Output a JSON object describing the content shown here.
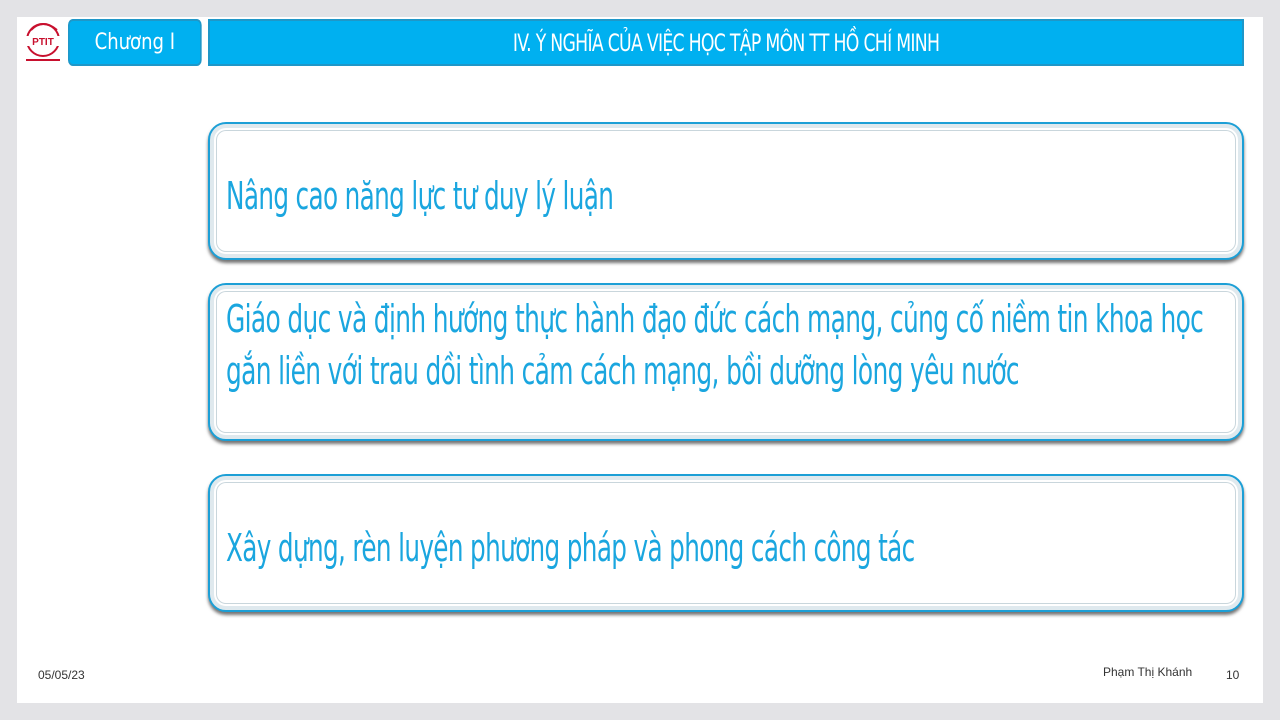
{
  "header": {
    "logo_text": "PTIT",
    "chapter": "Chương I",
    "title": "IV. Ý NGHĨA CỦA VIỆC HỌC TẬP MÔN TT HỒ CHÍ MINH"
  },
  "items": [
    {
      "text": "Nâng cao năng lực tư duy lý luận"
    },
    {
      "text": "Giáo dục và định hướng thực hành đạo đức cách mạng, củng cố niềm tin khoa học gắn liền với trau dồi tình cảm cách mạng, bồi dưỡng lòng yêu nước"
    },
    {
      "text": "Xây dựng, rèn luyện phương pháp và phong cách công tác"
    }
  ],
  "footer": {
    "date": "05/05/23",
    "author": "Phạm Thị Khánh",
    "page": "10"
  },
  "colors": {
    "accent": "#00b0f0",
    "text_blue": "#1aa6df",
    "logo_red": "#c8102e"
  }
}
